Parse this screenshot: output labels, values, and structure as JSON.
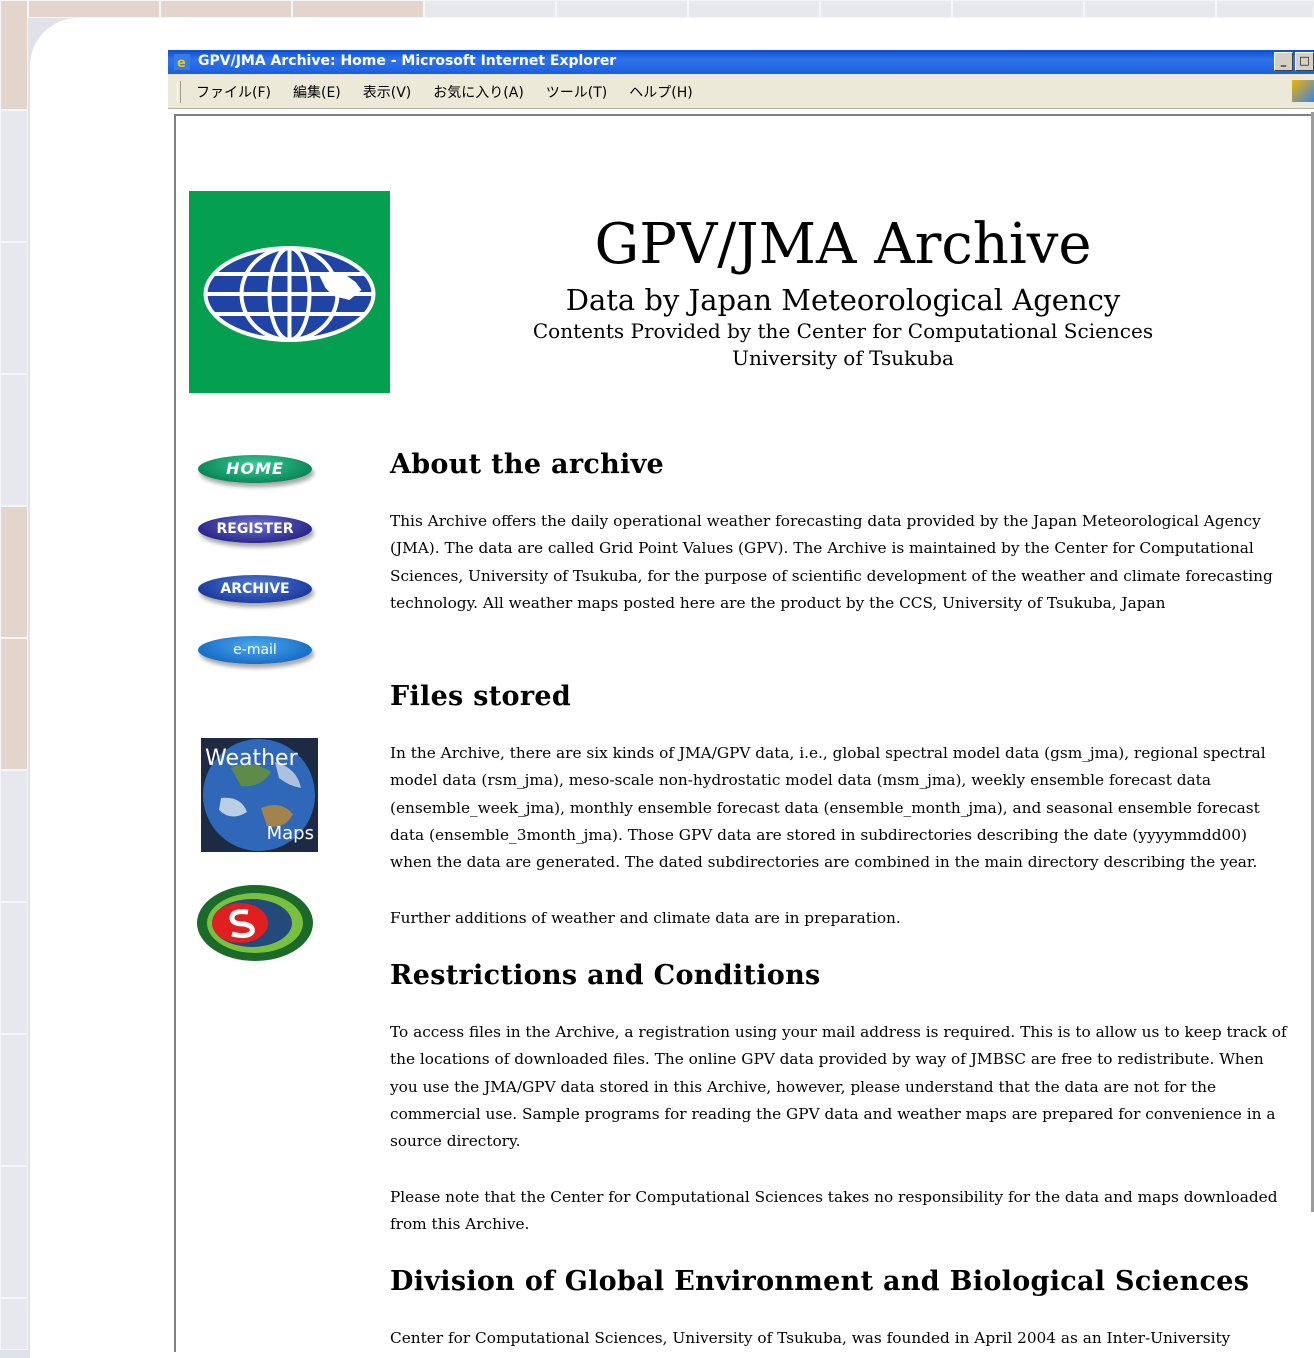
{
  "window": {
    "title": "GPV/JMA Archive: Home - Microsoft Internet Explorer",
    "buttons": [
      "_",
      "□"
    ]
  },
  "menu": {
    "items": [
      "ファイル(F)",
      "編集(E)",
      "表示(V)",
      "お気に入り(A)",
      "ツール(T)",
      "ヘルプ(H)"
    ]
  },
  "header": {
    "title": "GPV/JMA Archive",
    "subtitle": "Data by Japan Meteorological Agency",
    "provider": "Contents Provided by the Center for Computational Sciences",
    "university": "University of Tsukuba"
  },
  "nav": {
    "home": "HOME",
    "register": "REGISTER",
    "archive": "ARCHIVE",
    "email": "e-mail"
  },
  "weather_maps": {
    "word1": "Weather",
    "word2": "Maps"
  },
  "sections": {
    "about": {
      "heading": "About the archive",
      "text": "This Archive offers the daily operational weather forecasting data provided by the Japan Meteorological Agency (JMA). The data are called Grid Point Values (GPV). The Archive is maintained by the Center for Computational Sciences, University of Tsukuba, for the purpose of scientific development of the weather and climate forecasting technology. All weather maps posted here are the product by the CCS, University of Tsukuba, Japan"
    },
    "files": {
      "heading": "Files stored",
      "text": "In the Archive, there are six kinds of JMA/GPV data, i.e., global spectral model data (gsm_jma), regional spectral model data (rsm_jma), meso-scale non-hydrostatic model data (msm_jma), weekly ensemble forecast data (ensemble_week_jma), monthly ensemble forecast data (ensemble_month_jma), and seasonal ensemble forecast data (ensemble_3month_jma). Those GPV data are stored in subdirectories describing the date (yyyymmdd00) when the data are generated. The dated subdirectories are combined in the main directory describing the year.",
      "text2": "Further additions of weather and climate data are in preparation."
    },
    "restrictions": {
      "heading": "Restrictions and Conditions",
      "text": "To access files in the Archive, a registration using your mail address is required. This is to allow us to keep track of the locations of downloaded files. The online GPV data provided by way of JMBSC are free to redistribute. When you use the JMA/GPV data stored in this Archive, however, please understand that the data are not for the commercial use. Sample programs for reading the GPV data and weather maps are prepared for convenience in a source directory.",
      "text2": "Please note that the Center for Computational Sciences takes no responsibility for the data and maps downloaded from this Archive."
    },
    "division": {
      "heading": "Division of Global Environment and Biological Sciences",
      "text": "Center for Computational Sciences, University of Tsukuba, was founded in April 2004 as an Inter-University"
    }
  }
}
